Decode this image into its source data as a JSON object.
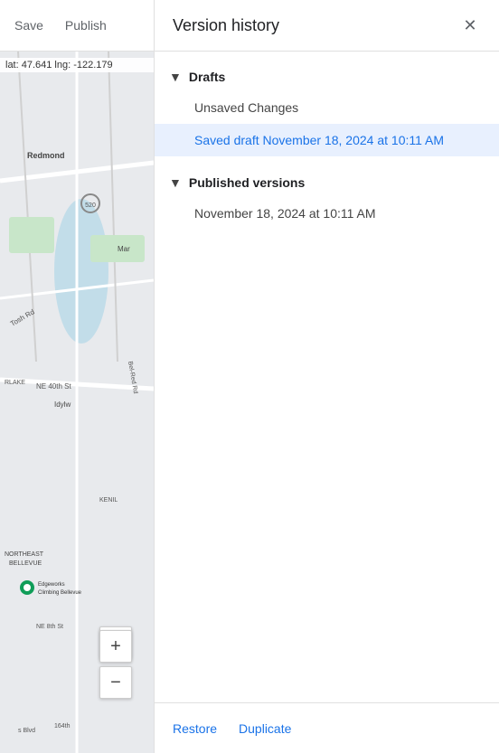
{
  "toolbar": {
    "save_label": "Save",
    "publish_label": "Publish"
  },
  "map": {
    "coords": "lat: 47.641  lng: -122.179",
    "location_btn_icon": "⊙"
  },
  "panel": {
    "title": "Version history",
    "close_icon": "✕",
    "sections": [
      {
        "id": "drafts",
        "label": "Drafts",
        "expanded": true,
        "items": [
          {
            "id": "unsaved",
            "label": "Unsaved Changes",
            "selected": false
          },
          {
            "id": "saved-draft",
            "label": "Saved draft November 18, 2024 at 10:11 AM",
            "selected": true
          }
        ]
      },
      {
        "id": "published",
        "label": "Published versions",
        "expanded": true,
        "items": [
          {
            "id": "pub-1",
            "label": "November 18, 2024 at 10:11 AM",
            "selected": false
          }
        ]
      }
    ],
    "footer": {
      "restore_label": "Restore",
      "duplicate_label": "Duplicate"
    }
  }
}
